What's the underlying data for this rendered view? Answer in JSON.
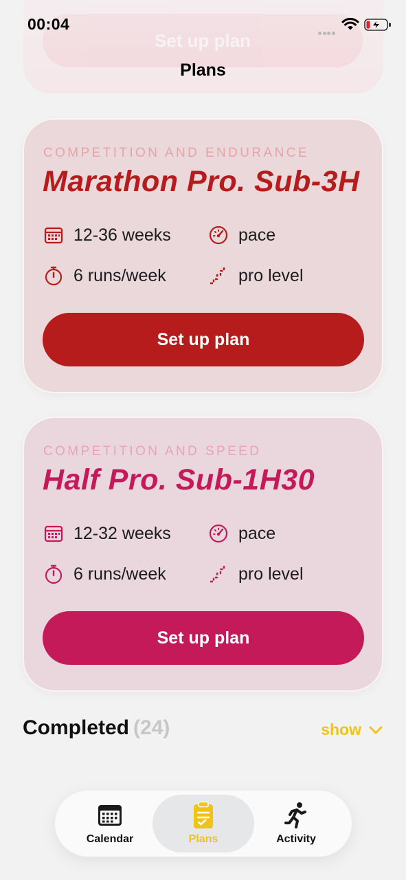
{
  "status_bar": {
    "time": "00:04"
  },
  "header": {
    "title": "Plans",
    "ghost_button_label": "Set up plan"
  },
  "plans": [
    {
      "category": "COMPETITION AND ENDURANCE",
      "title": "Marathon Pro. Sub-3H",
      "duration": "12-36 weeks",
      "focus": "pace",
      "frequency": "6 runs/week",
      "level": "pro level",
      "button_label": "Set up plan",
      "accent_color": "#b61c1c",
      "category_color": "#e6a3a8"
    },
    {
      "category": "COMPETITION AND SPEED",
      "title": "Half Pro. Sub-1H30",
      "duration": "12-32 weeks",
      "focus": "pace",
      "frequency": "6 runs/week",
      "level": "pro level",
      "button_label": "Set up plan",
      "accent_color": "#c41a5a",
      "category_color": "#e5a4bb"
    }
  ],
  "completed": {
    "title": "Completed",
    "count": "(24)",
    "show_label": "show"
  },
  "tab_bar": {
    "tabs": [
      {
        "label": "Calendar",
        "icon": "calendar-icon",
        "active": false
      },
      {
        "label": "Plans",
        "icon": "clipboard-icon",
        "active": true
      },
      {
        "label": "Activity",
        "icon": "runner-icon",
        "active": false
      }
    ],
    "active_color": "#f2c317"
  }
}
